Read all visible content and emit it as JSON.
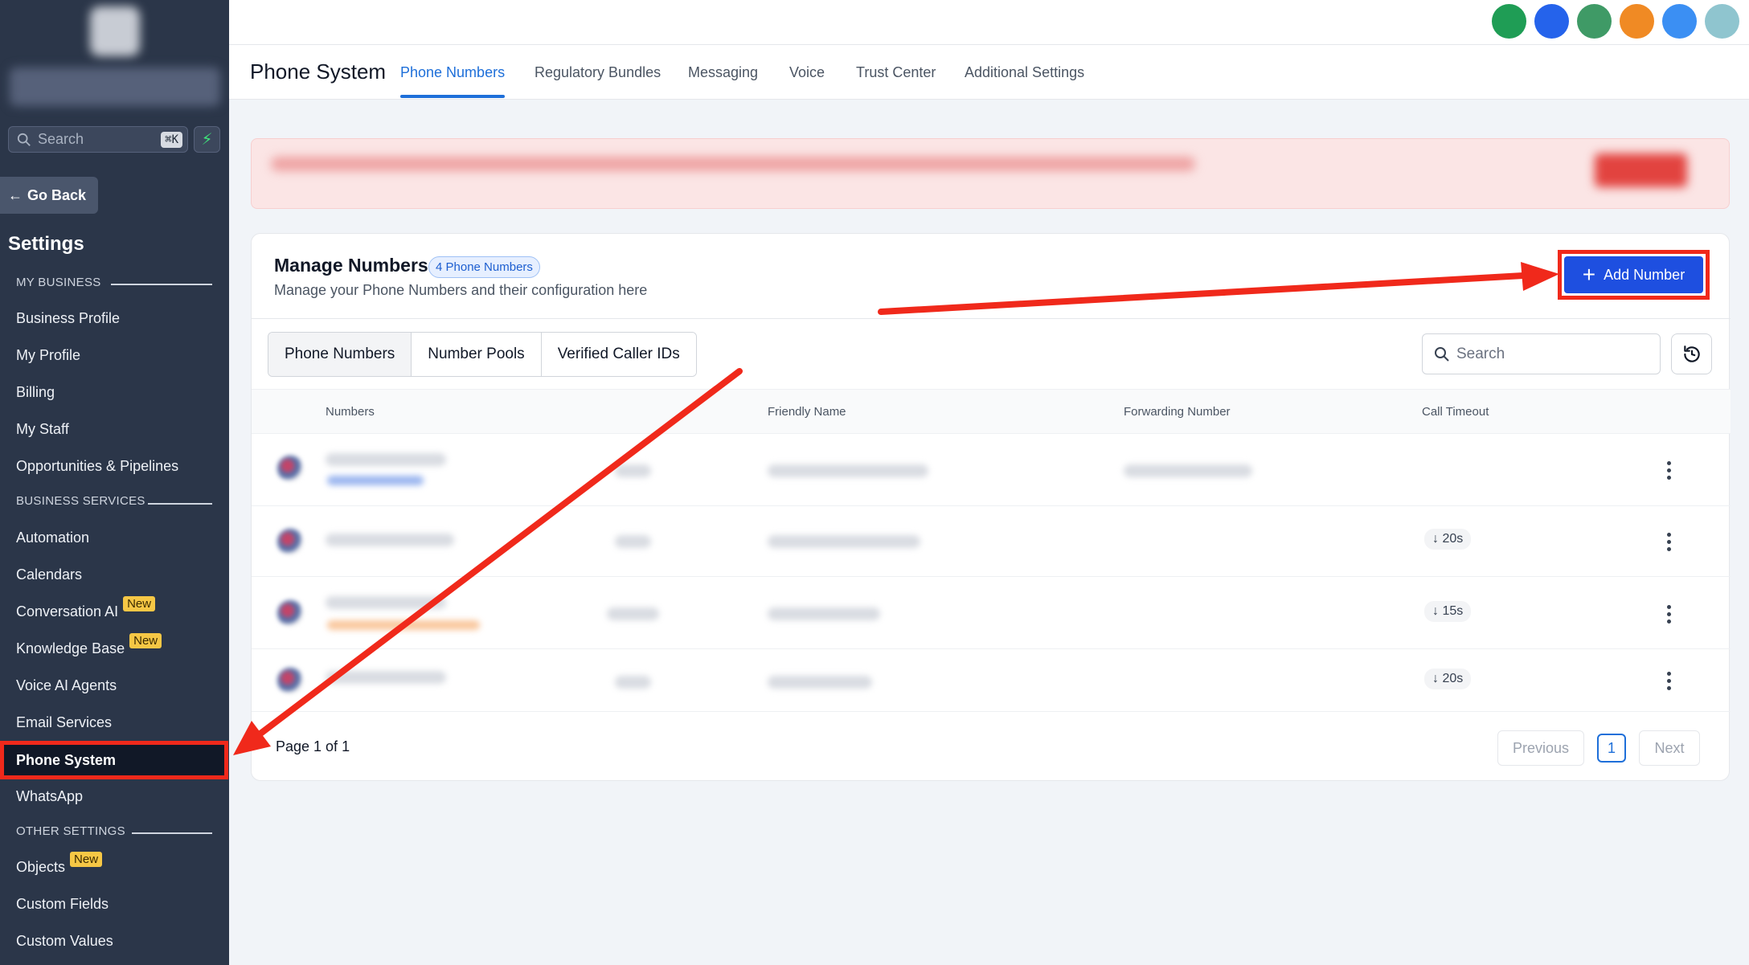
{
  "sidebar": {
    "search_placeholder": "Search",
    "search_shortcut": "⌘K",
    "go_back": "Go Back",
    "settings_title": "Settings",
    "sections": {
      "my_business": "MY BUSINESS",
      "business_services": "BUSINESS SERVICES",
      "other_settings": "OTHER SETTINGS"
    },
    "items": {
      "business_profile": "Business Profile",
      "my_profile": "My Profile",
      "billing": "Billing",
      "my_staff": "My Staff",
      "opportunities": "Opportunities & Pipelines",
      "automation": "Automation",
      "calendars": "Calendars",
      "conversation_ai": "Conversation AI",
      "knowledge_base": "Knowledge Base",
      "voice_ai_agents": "Voice AI Agents",
      "email_services": "Email Services",
      "phone_system": "Phone System",
      "whatsapp": "WhatsApp",
      "objects": "Objects",
      "custom_fields": "Custom Fields",
      "custom_values": "Custom Values"
    },
    "badge_new": "New"
  },
  "header": {
    "title": "Phone System",
    "tabs": [
      "Phone Numbers",
      "Regulatory Bundles",
      "Messaging",
      "Voice",
      "Trust Center",
      "Additional Settings"
    ],
    "active_tab": "Phone Numbers"
  },
  "top_icons": [
    "phone-icon",
    "chat-icon",
    "megaphone-icon",
    "notifications-icon",
    "help-icon",
    "avatar"
  ],
  "colors": {
    "accent": "#1e6fd9",
    "primary_button": "#1e4fe0",
    "sidebar_bg": "#2b3649",
    "highlight": "#f0291b",
    "badge_new": "#f6c745"
  },
  "card": {
    "title": "Manage Numbers",
    "count_badge": "4 Phone Numbers",
    "description": "Manage your Phone Numbers and their configuration here",
    "add_button": "Add Number",
    "segments": [
      "Phone Numbers",
      "Number Pools",
      "Verified Caller IDs"
    ],
    "search_placeholder": "Search",
    "columns": [
      "Numbers",
      "Friendly Name",
      "Forwarding Number",
      "Call Timeout"
    ],
    "rows": [
      {
        "timeout": ""
      },
      {
        "timeout": "20s"
      },
      {
        "timeout": "15s"
      },
      {
        "timeout": "20s"
      }
    ],
    "pagination": {
      "info": "Page 1 of 1",
      "previous": "Previous",
      "current": "1",
      "next": "Next"
    }
  }
}
